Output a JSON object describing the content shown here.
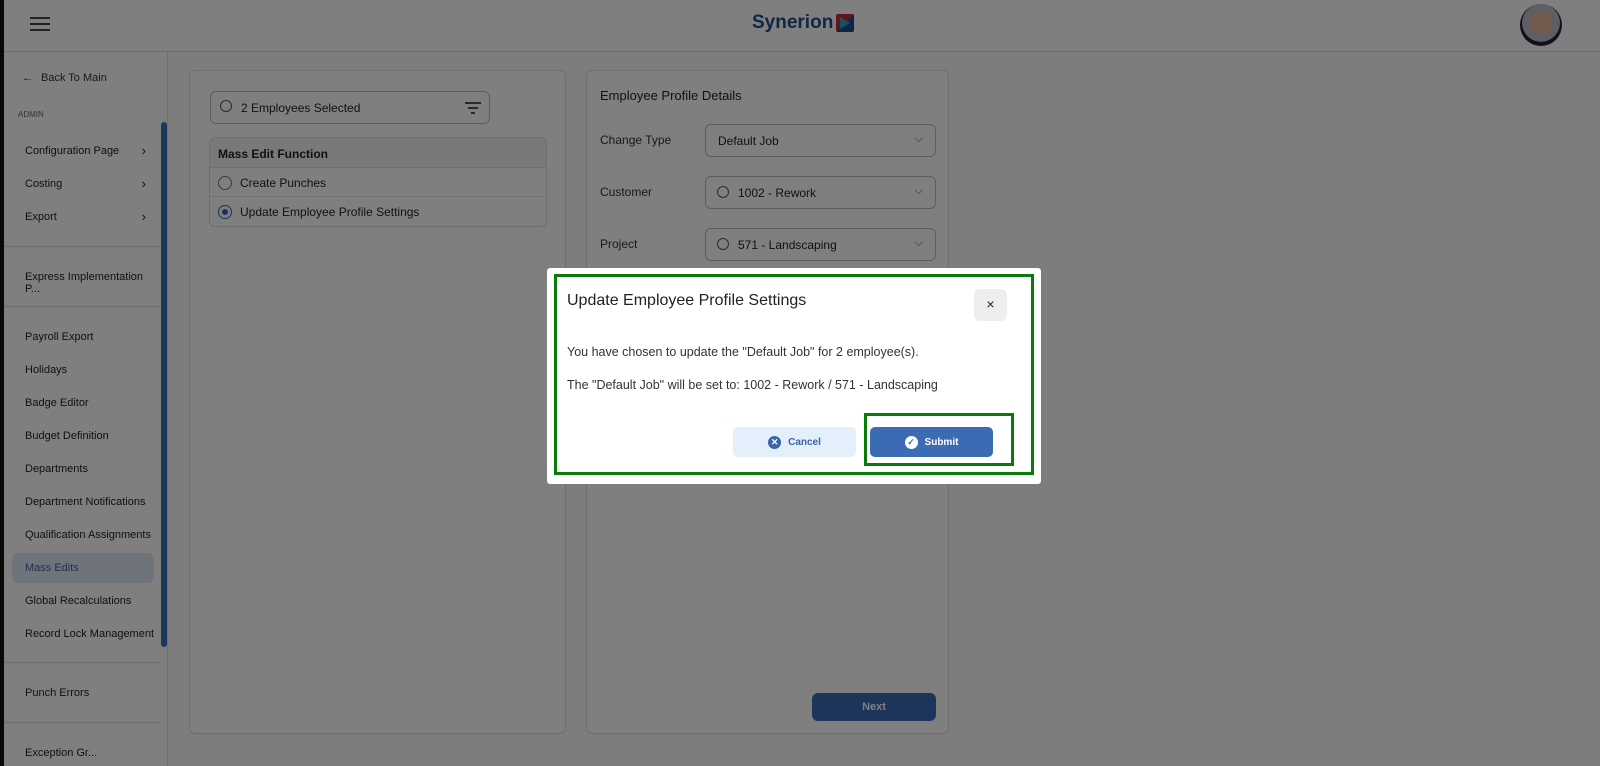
{
  "header": {
    "logo": "Synerion",
    "menu_icon": "hamburger-icon"
  },
  "sidebar": {
    "back": "Back To Main",
    "section": "ADMIN",
    "group1": [
      {
        "label": "Configuration Page"
      },
      {
        "label": "Costing"
      },
      {
        "label": "Export"
      }
    ],
    "group2": [
      {
        "label": "Express Implementation P..."
      }
    ],
    "group3": [
      {
        "label": "Payroll Export"
      },
      {
        "label": "Holidays"
      },
      {
        "label": "Badge Editor"
      },
      {
        "label": "Budget Definition"
      },
      {
        "label": "Departments"
      },
      {
        "label": "Department Notifications"
      },
      {
        "label": "Qualification Assignments"
      },
      {
        "label": "Mass Edits",
        "active": true
      },
      {
        "label": "Global Recalculations"
      },
      {
        "label": "Record Lock Management"
      }
    ],
    "group4": [
      {
        "label": "Punch Errors"
      }
    ],
    "group5": [
      {
        "label": "Exception Gr..."
      }
    ]
  },
  "left": {
    "search_value": "2 Employees Selected",
    "mass_edit_title": "Mass Edit Function",
    "options": [
      {
        "label": "Create Punches",
        "selected": false
      },
      {
        "label": "Update Employee Profile Settings",
        "selected": true
      }
    ]
  },
  "right": {
    "title": "Employee Profile Details",
    "fields": [
      {
        "label": "Change Type",
        "value": "Default Job"
      },
      {
        "label": "Customer",
        "value": "1002 - Rework"
      },
      {
        "label": "Project",
        "value": "571 - Landscaping"
      }
    ],
    "next": "Next"
  },
  "modal": {
    "title": "Update Employee Profile Settings",
    "close": "×",
    "line1": "You have chosen to update the \"Default Job\" for 2 employee(s).",
    "line2": "The \"Default Job\" will be set to: 1002 - Rework / 571 - Landscaping",
    "cancel": "Cancel",
    "submit": "Submit",
    "highlight_color": "#0a7a0a",
    "accent": "#3b6bb5"
  }
}
